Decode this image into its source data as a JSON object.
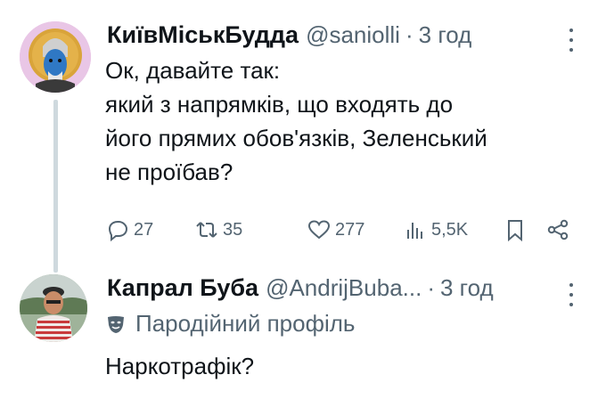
{
  "tweet1": {
    "display_name": "КиївМіськБудда",
    "handle": "@saniolli",
    "separator": "·",
    "time": "3 год",
    "text_lines": [
      "Ок, давайте так:",
      "який з напрямків, що входять до",
      "його прямих обов'язків, Зеленський",
      "не проїбав?"
    ],
    "stats": {
      "replies": "27",
      "reposts": "35",
      "likes": "277",
      "views": "5,5K"
    }
  },
  "tweet2": {
    "display_name": "Капрал Буба",
    "handle": "@AndrijBuba...",
    "separator": "·",
    "time": "3 год",
    "label": "Пародійний профіль",
    "text": "Наркотрафік?"
  },
  "colors": {
    "text_primary": "#0f1419",
    "text_secondary": "#536471",
    "thread_line": "#cfd9de",
    "background": "#ffffff"
  }
}
